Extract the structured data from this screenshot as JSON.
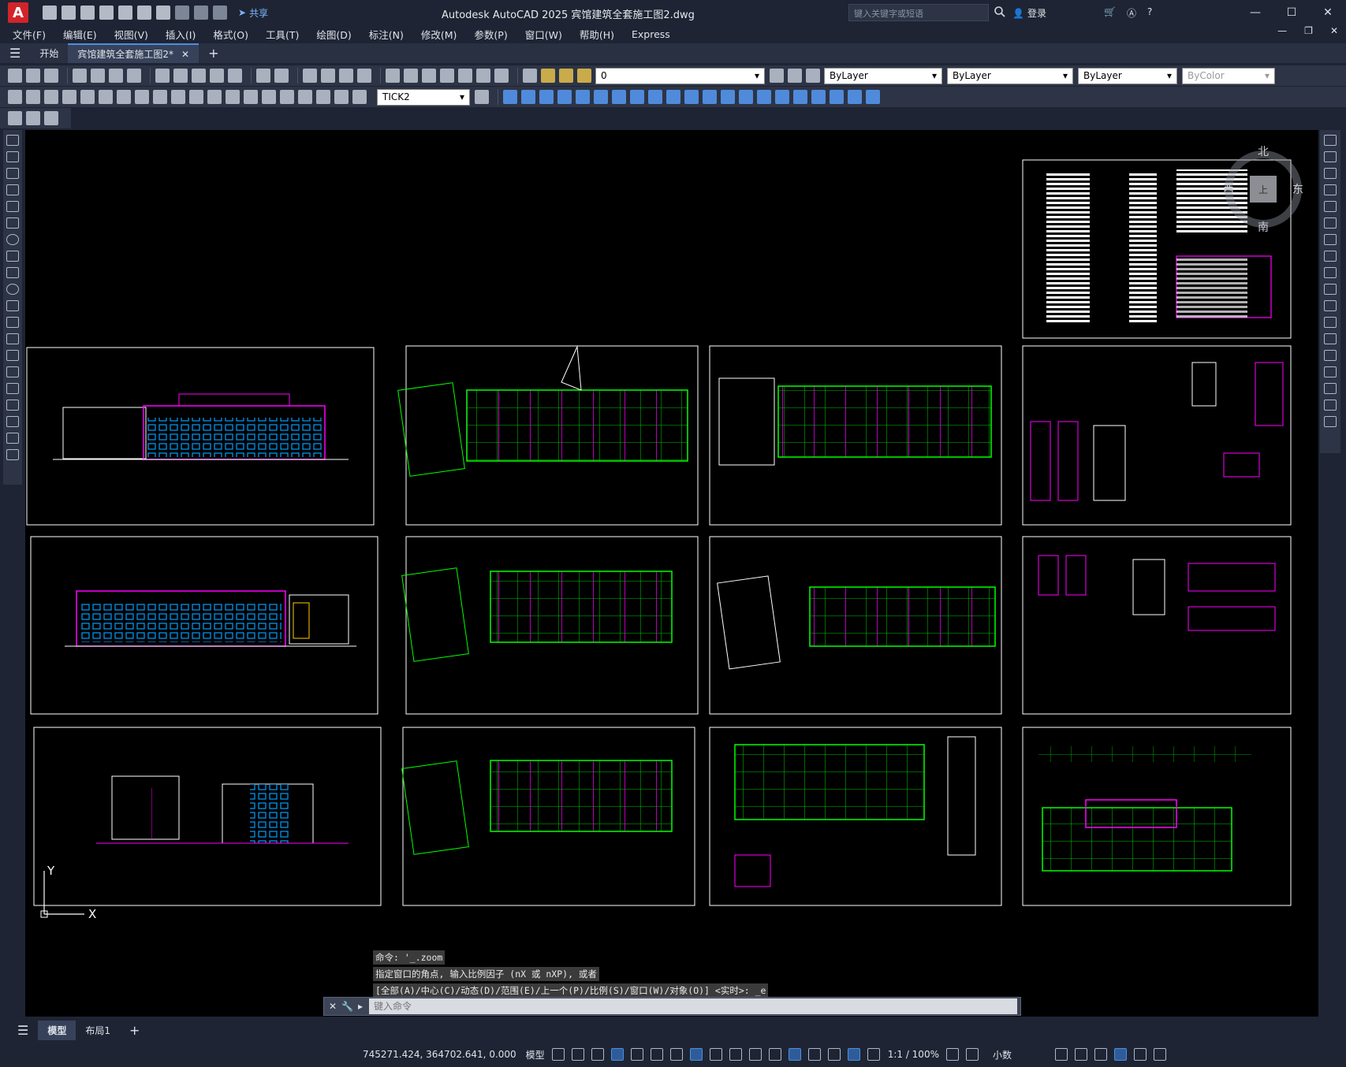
{
  "titlebar": {
    "app_letter": "A",
    "share_label": "共享",
    "title": "Autodesk AutoCAD 2025    宾馆建筑全套施工图2.dwg",
    "search_placeholder": "键入关键字或短语",
    "login_label": "登录"
  },
  "menubar": {
    "items": [
      "文件(F)",
      "编辑(E)",
      "视图(V)",
      "插入(I)",
      "格式(O)",
      "工具(T)",
      "绘图(D)",
      "标注(N)",
      "修改(M)",
      "参数(P)",
      "窗口(W)",
      "帮助(H)",
      "Express"
    ]
  },
  "tabs": {
    "start": "开始",
    "drawing": "宾馆建筑全套施工图2*",
    "add": "+"
  },
  "properties": {
    "layer_value": "0",
    "color": "ByLayer",
    "linetype": "ByLayer",
    "lineweight": "ByLayer",
    "plotstyle": "ByColor",
    "dimstyle": "TICK2"
  },
  "viewcube": {
    "north": "北",
    "south": "南",
    "east": "东",
    "west": "西",
    "top": "上"
  },
  "ucs": {
    "x": "X",
    "y": "Y"
  },
  "command": {
    "history": [
      "命令:  '_.zoom",
      "指定窗口的角点, 输入比例因子 (nX 或 nXP), 或者",
      "[全部(A)/中心(C)/动态(D)/范围(E)/上一个(P)/比例(S)/窗口(W)/对象(O)] <实时>: _e"
    ],
    "placeholder": "键入命令"
  },
  "layouts": {
    "model": "模型",
    "layout1": "布局1",
    "add": "+"
  },
  "status": {
    "coordinates": "745271.424, 364702.641, 0.000",
    "mode": "模型",
    "scale": "1:1 / 100%",
    "units": "小数"
  },
  "colors": {
    "accent": "#4a8fe0",
    "canvas": "#000000",
    "chrome": "#1e2433",
    "green": "#00ff00",
    "magenta": "#ff00ff"
  }
}
